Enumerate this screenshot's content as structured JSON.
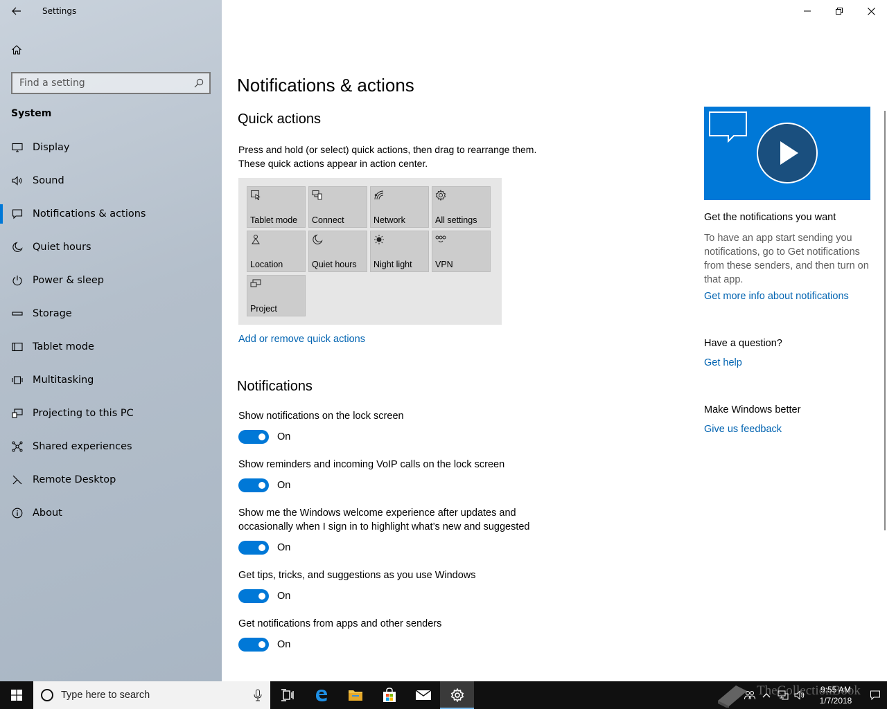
{
  "window": {
    "title": "Settings",
    "controls": {
      "minimize": "minimize",
      "restore": "restore",
      "close": "close"
    }
  },
  "sidebar": {
    "search_placeholder": "Find a setting",
    "section": "System",
    "items": [
      {
        "label": "Display",
        "icon": "monitor-icon"
      },
      {
        "label": "Sound",
        "icon": "speaker-icon"
      },
      {
        "label": "Notifications & actions",
        "icon": "notification-icon",
        "selected": true
      },
      {
        "label": "Quiet hours",
        "icon": "moon-icon"
      },
      {
        "label": "Power & sleep",
        "icon": "power-icon"
      },
      {
        "label": "Storage",
        "icon": "storage-icon"
      },
      {
        "label": "Tablet mode",
        "icon": "tablet-icon"
      },
      {
        "label": "Multitasking",
        "icon": "multitasking-icon"
      },
      {
        "label": "Projecting to this PC",
        "icon": "projecting-icon"
      },
      {
        "label": "Shared experiences",
        "icon": "share-icon"
      },
      {
        "label": "Remote Desktop",
        "icon": "remote-desktop-icon"
      },
      {
        "label": "About",
        "icon": "info-icon"
      }
    ]
  },
  "main": {
    "title": "Notifications & actions",
    "quick_actions": {
      "heading": "Quick actions",
      "description": "Press and hold (or select) quick actions, then drag to rearrange them. These quick actions appear in action center.",
      "tiles": [
        {
          "label": "Tablet mode",
          "icon": "tablet-mode-icon"
        },
        {
          "label": "Connect",
          "icon": "connect-icon"
        },
        {
          "label": "Network",
          "icon": "network-icon"
        },
        {
          "label": "All settings",
          "icon": "gear-icon"
        },
        {
          "label": "Location",
          "icon": "location-icon"
        },
        {
          "label": "Quiet hours",
          "icon": "moon-icon"
        },
        {
          "label": "Night light",
          "icon": "brightness-icon"
        },
        {
          "label": "VPN",
          "icon": "vpn-icon"
        },
        {
          "label": "Project",
          "icon": "project-icon"
        }
      ],
      "link": "Add or remove quick actions"
    },
    "notifications": {
      "heading": "Notifications",
      "settings": [
        {
          "label": "Show notifications on the lock screen",
          "state": "On"
        },
        {
          "label": "Show reminders and incoming VoIP calls on the lock screen",
          "state": "On"
        },
        {
          "label": "Show me the Windows welcome experience after updates and occasionally when I sign in to highlight what’s new and suggested",
          "state": "On"
        },
        {
          "label": "Get tips, tricks, and suggestions as you use Windows",
          "state": "On"
        },
        {
          "label": "Get notifications from apps and other senders",
          "state": "On"
        }
      ]
    }
  },
  "right_column": {
    "video_title": "Get the notifications you want",
    "video_text": "To have an app start sending you notifications, go to Get notifications from these senders, and then turn on that app.",
    "video_link": "Get more info about notifications",
    "question_title": "Have a question?",
    "question_link": "Get help",
    "feedback_title": "Make Windows better",
    "feedback_link": "Give us feedback"
  },
  "taskbar": {
    "search_placeholder": "Type here to search",
    "time": "9:55 AM",
    "date": "1/7/2018",
    "watermark": "TheCollectionBook"
  },
  "colors": {
    "accent": "#0078d7",
    "link": "#0063b1",
    "sidebar_bg": "#b4bfcb",
    "tile_bg": "#cccccc",
    "taskbar_bg": "#101010"
  }
}
